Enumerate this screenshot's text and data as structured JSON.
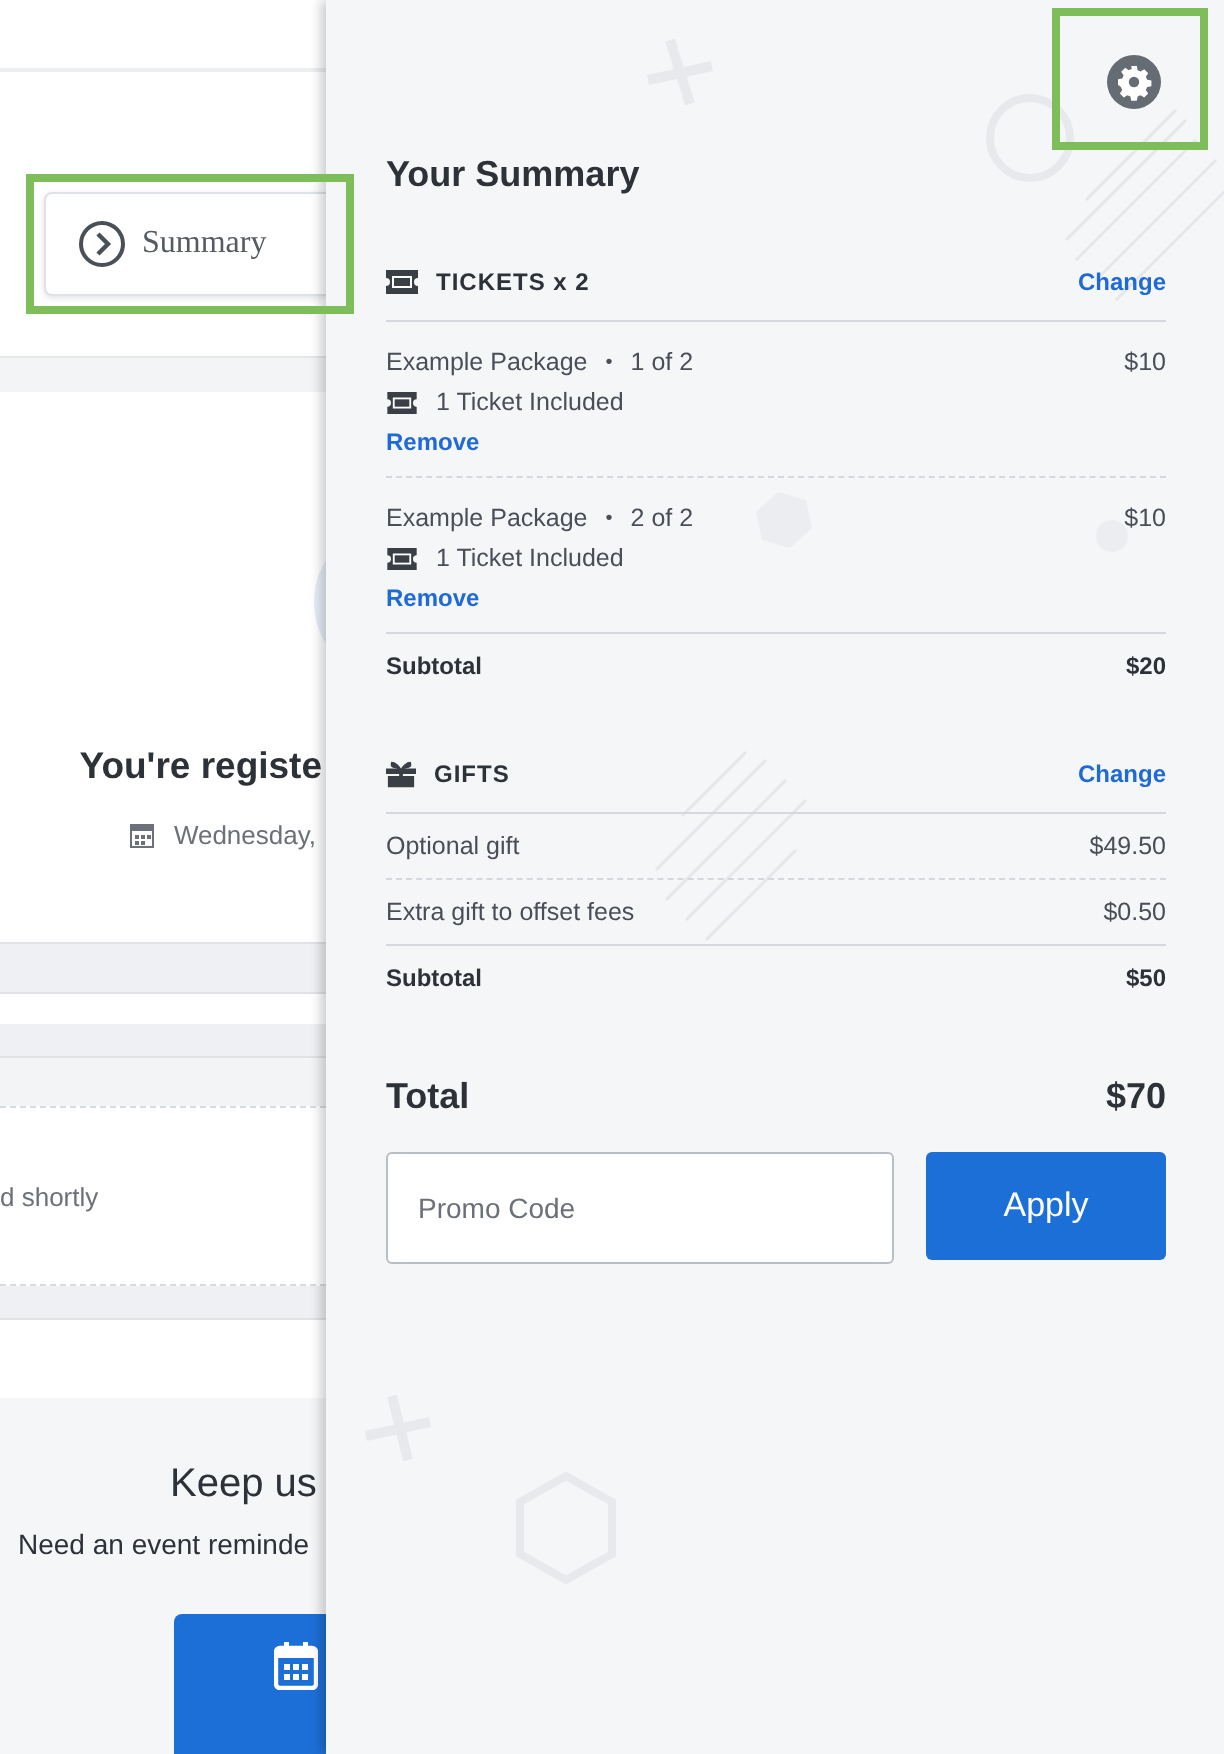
{
  "page": {
    "summary_button": "Summary",
    "heading": "You're registe",
    "date": "Wednesday,",
    "status_text": "d shortly",
    "reminder_heading": "Keep us",
    "reminder_text": "Need an event reminde"
  },
  "summary_panel": {
    "title": "Your Summary",
    "sections": [
      {
        "kind": "tickets",
        "title": "TICKETS x 2",
        "action": "Change",
        "items": [
          {
            "kind": "package",
            "name": "Example Package",
            "separator": "•",
            "position": "1 of 2",
            "price": "$10",
            "includes": "1 Ticket Included",
            "action": "Remove"
          },
          {
            "kind": "package",
            "name": "Example Package",
            "separator": "•",
            "position": "2 of 2",
            "price": "$10",
            "includes": "1 Ticket Included",
            "action": "Remove"
          }
        ],
        "subtotal_label": "Subtotal",
        "subtotal": "$20"
      },
      {
        "kind": "gifts",
        "title": "GIFTS",
        "action": "Change",
        "items": [
          {
            "kind": "line",
            "name": "Optional gift",
            "price": "$49.50"
          },
          {
            "kind": "line",
            "name": "Extra gift to offset fees",
            "price": "$0.50"
          }
        ],
        "subtotal_label": "Subtotal",
        "subtotal": "$50"
      }
    ],
    "total_label": "Total",
    "total": "$70",
    "promo": {
      "placeholder": "Promo Code"
    },
    "apply_button": "Apply"
  }
}
